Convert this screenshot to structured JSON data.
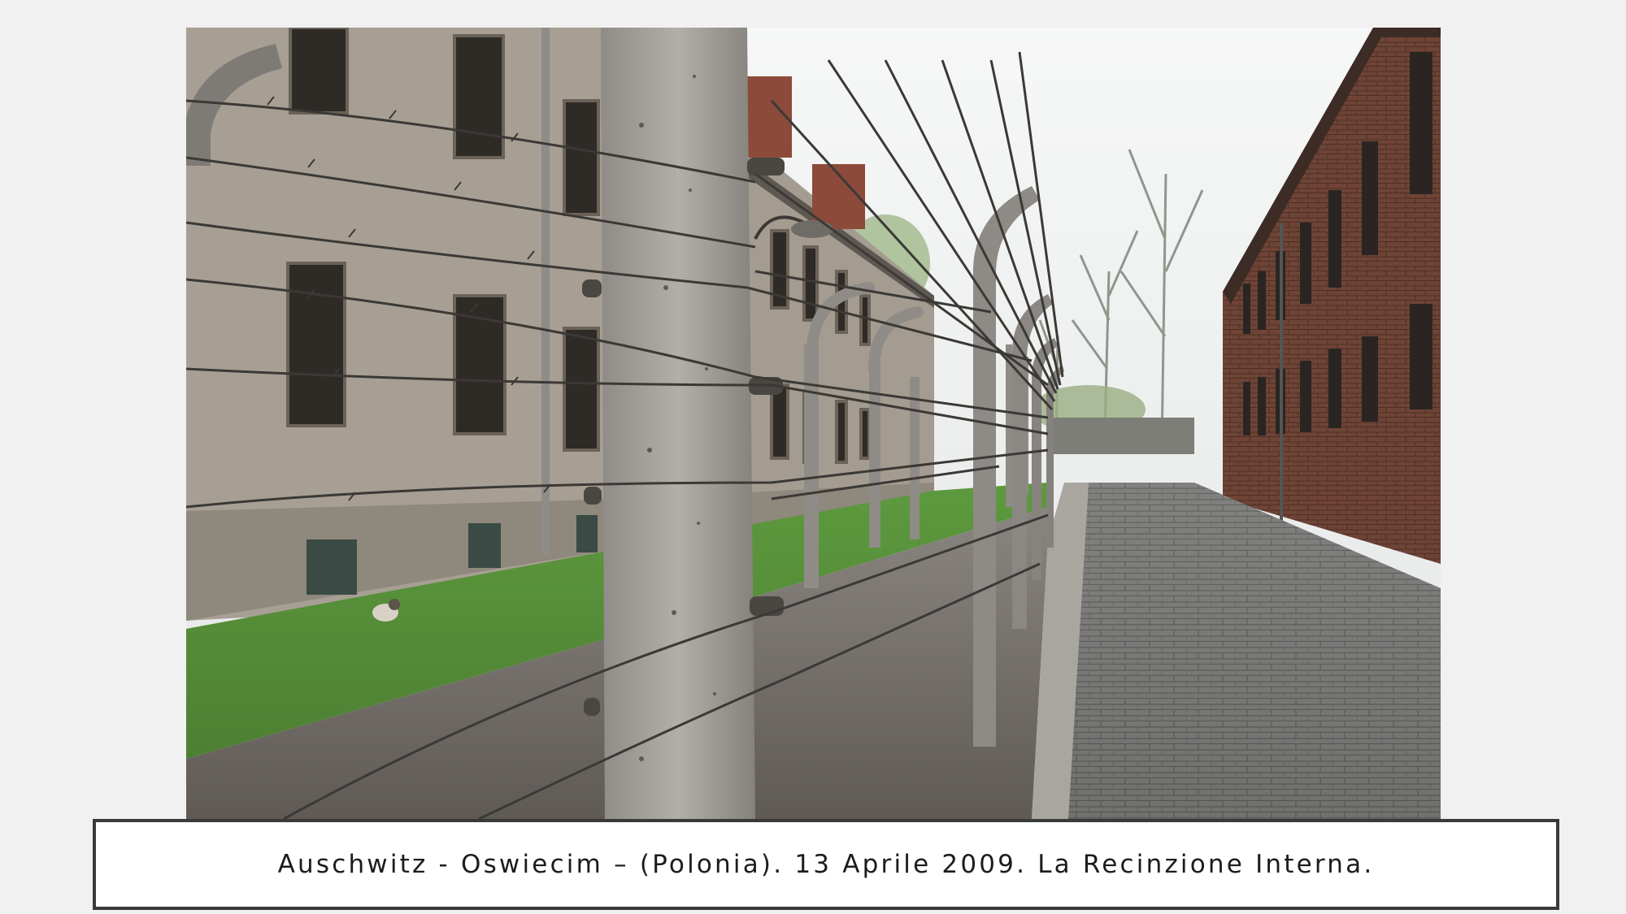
{
  "caption": {
    "text": "Auschwitz - Oswiecim – (Polonia). 13 Aprile 2009. La Recinzione Interna."
  },
  "colors": {
    "background": "#f1f1f1",
    "caption_border": "#3a3a3a",
    "caption_text": "#1c1c1c"
  }
}
